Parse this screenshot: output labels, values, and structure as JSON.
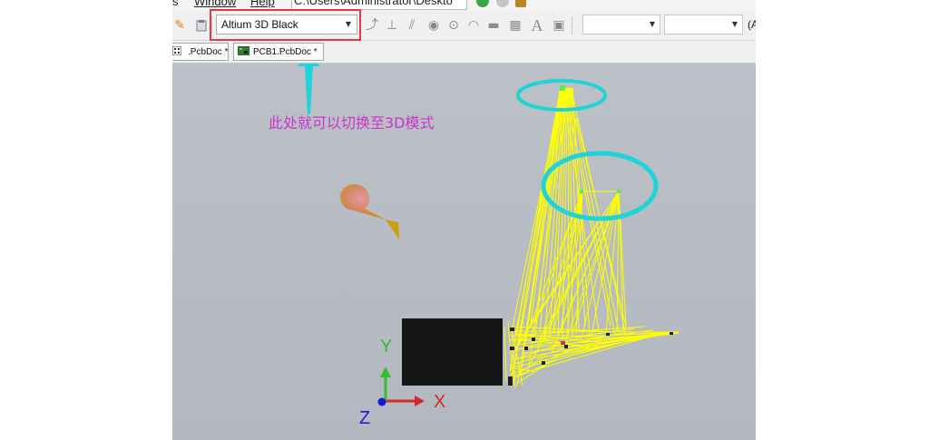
{
  "menubar": {
    "items": [
      {
        "label": "s",
        "underline": false
      },
      {
        "label": "Window",
        "underline": true
      },
      {
        "label": "Help",
        "underline": true
      }
    ],
    "path": "C:\\Users\\Administrator\\Deskto"
  },
  "toolbar": {
    "view_select": {
      "value": "Altium 3D Black"
    },
    "trailing_text": "(A",
    "icons": [
      "pencil-icon",
      "clipboard-icon",
      "route-icon",
      "fanout-icon",
      "diff-pair-icon",
      "via-icon",
      "pad-icon",
      "arc-icon",
      "fill-icon",
      "polygon-icon",
      "text-icon",
      "component-icon"
    ]
  },
  "tabs": [
    {
      "label": ".PcbDoc *"
    },
    {
      "label": "PCB1.PcbDoc *"
    }
  ],
  "viewport": {
    "annotation": "此处就可以切换至3D模式",
    "axes": {
      "x": "X",
      "y": "Y",
      "z": "Z"
    },
    "colors": {
      "background": "#b8bcc4",
      "ratsnest": "#ffff00",
      "component": "#161616",
      "annotation_text": "#cc33cc",
      "annotation_marks": "#1fd3d8",
      "highlight_box": "#e5393f"
    }
  }
}
